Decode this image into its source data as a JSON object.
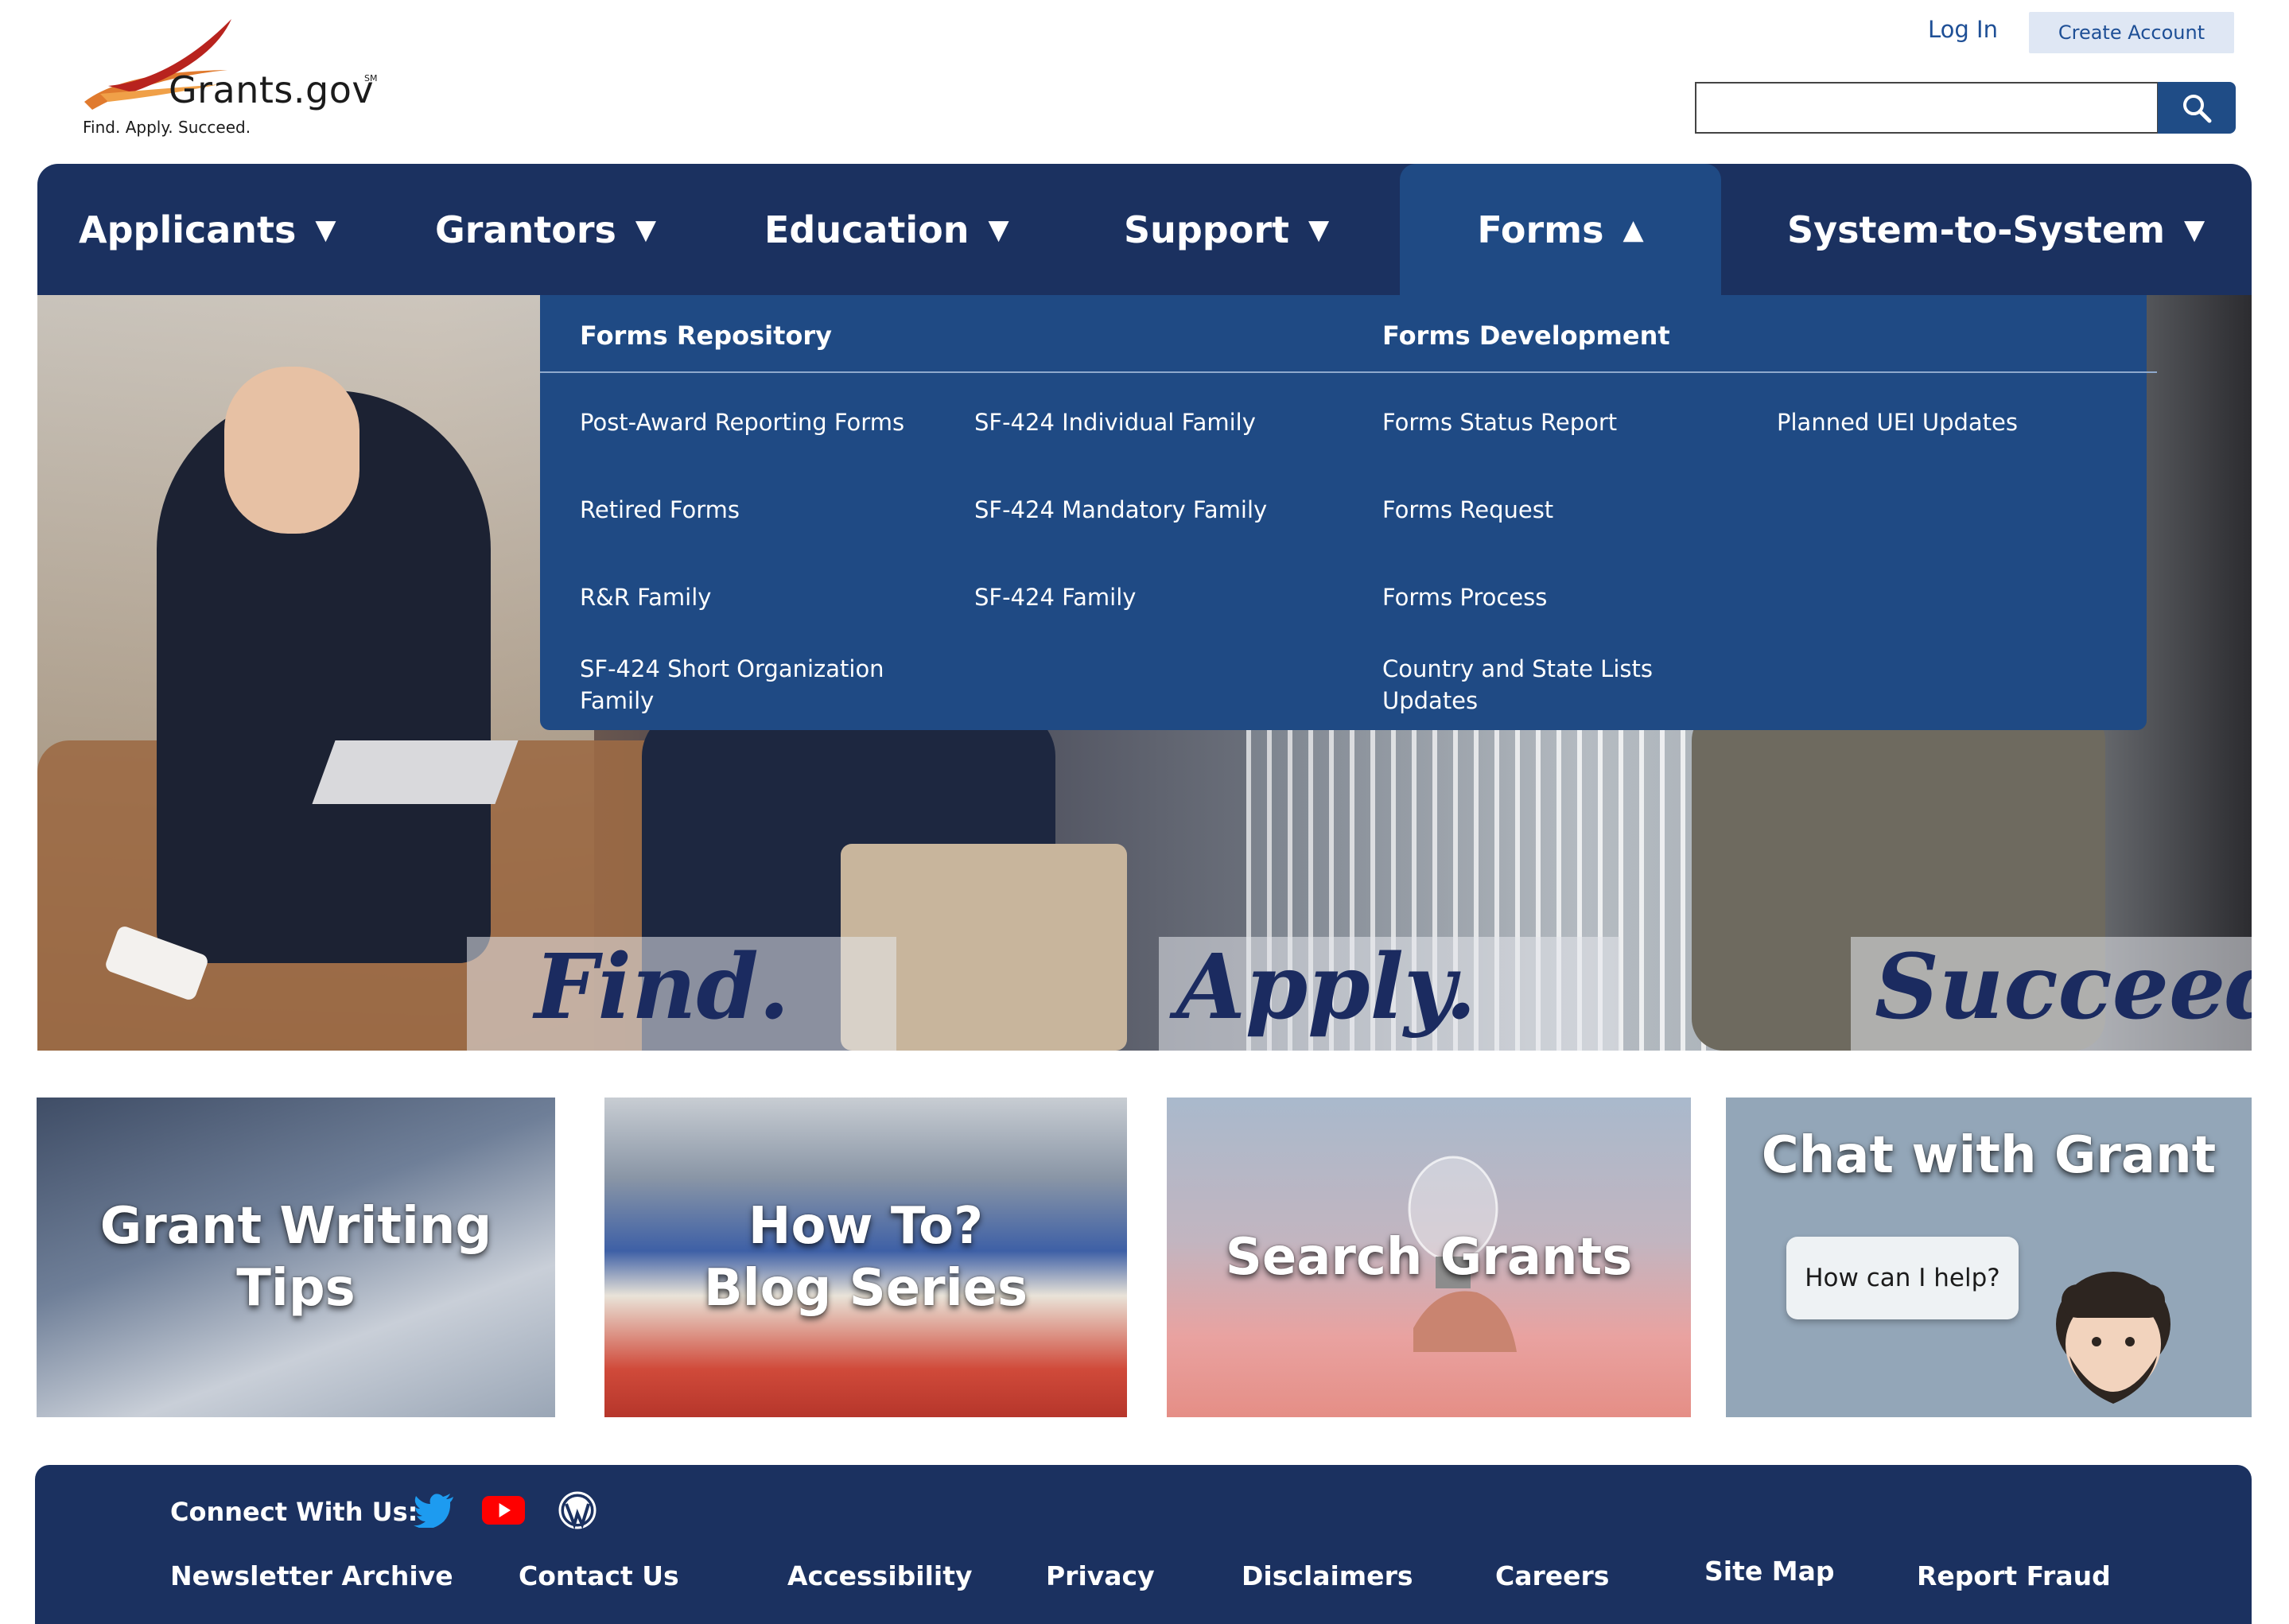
{
  "header": {
    "logo_text": "Grants.gov",
    "logo_sm": "SM",
    "tagline": "Find. Apply. Succeed.",
    "login_label": "Log In",
    "create_account_label": "Create Account",
    "search_value": ""
  },
  "nav": {
    "items": [
      {
        "label": "Applicants",
        "arrow": "▼"
      },
      {
        "label": "Grantors",
        "arrow": "▼"
      },
      {
        "label": "Education",
        "arrow": "▼"
      },
      {
        "label": "Support",
        "arrow": "▼"
      },
      {
        "label": "Forms",
        "arrow": "▲"
      },
      {
        "label": "System-to-System",
        "arrow": "▼"
      }
    ],
    "active": "Forms"
  },
  "dropdown": {
    "heading_left": "Forms Repository",
    "heading_right": "Forms Development",
    "links": [
      "Post-Award Reporting Forms",
      "Retired Forms",
      "R&R Family",
      "SF-424 Short Organization Family",
      "SF-424 Individual Family",
      "SF-424 Mandatory Family",
      "SF-424 Family",
      "Forms Status Report",
      "Forms Request",
      "Forms Process",
      "Country and State Lists Updates",
      "Planned UEI Updates"
    ]
  },
  "hero": {
    "words": [
      "Find.",
      "Apply.",
      "Succeed."
    ]
  },
  "cards": [
    {
      "title_line1": "Grant Writing",
      "title_line2": "Tips"
    },
    {
      "title_line1": "How To?",
      "title_line2": "Blog Series"
    },
    {
      "title_line1": "Search Grants",
      "title_line2": ""
    },
    {
      "title_line1": "Chat with Grant",
      "title_line2": "",
      "bubble": "How can I help?"
    }
  ],
  "footer": {
    "connect_label": "Connect With Us:",
    "social_icons": [
      "twitter-icon",
      "youtube-icon",
      "wordpress-icon"
    ],
    "links": [
      "Newsletter Archive",
      "Contact Us",
      "Accessibility",
      "Privacy",
      "Disclaimers",
      "Careers",
      "Site Map",
      "Report Fraud"
    ]
  },
  "colors": {
    "nav_bg": "#1b3160",
    "dropdown_bg": "#1f4a84",
    "link_blue": "#1e4f96",
    "hero_text": "#1b2b60"
  }
}
